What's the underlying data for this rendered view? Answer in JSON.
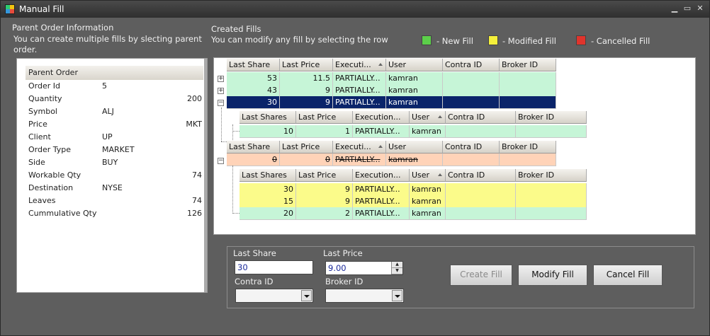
{
  "window": {
    "title": "Manual Fill"
  },
  "parent_section": {
    "title": "Parent Order Information",
    "subtitle": "You can create multiple fills by slecting parent order."
  },
  "parent_order": {
    "header": "Parent Order",
    "rows": [
      {
        "key": "Order Id",
        "value": "5",
        "align": "left"
      },
      {
        "key": "Quantity",
        "value": "200",
        "align": "right"
      },
      {
        "key": "Symbol",
        "value": "ALJ",
        "align": "left"
      },
      {
        "key": "Price",
        "value": "MKT",
        "align": "right"
      },
      {
        "key": "Client",
        "value": "UP",
        "align": "left"
      },
      {
        "key": "Order Type",
        "value": "MARKET",
        "align": "left"
      },
      {
        "key": "Side",
        "value": "BUY",
        "align": "left"
      },
      {
        "key": "Workable Qty",
        "value": "74",
        "align": "right"
      },
      {
        "key": "Destination",
        "value": "NYSE",
        "align": "left"
      },
      {
        "key": "Leaves",
        "value": "74",
        "align": "right"
      },
      {
        "key": "Cummulative Qty",
        "value": "126",
        "align": "right"
      }
    ]
  },
  "fills_section": {
    "title": "Created Fills",
    "subtitle": "You can modify any fill by selecting the row"
  },
  "legend": [
    {
      "color": "#5ccf4a",
      "label": "- New Fill"
    },
    {
      "color": "#f5f03a",
      "label": "- Modified Fill"
    },
    {
      "color": "#e0342c",
      "label": "- Cancelled Fill"
    }
  ],
  "grid": {
    "parent_columns": [
      "Last Share",
      "Last Price",
      "Executi...",
      "User",
      "Contra ID",
      "Broker ID"
    ],
    "child_columns": [
      "Last Shares",
      "Last Price",
      "Execution...",
      "User",
      "Contra ID",
      "Broker ID"
    ],
    "groups": [
      {
        "status": "new",
        "expanded": false,
        "expander": "+",
        "row": {
          "last_share": "53",
          "last_price": "11.5",
          "execution": "PARTIALLY...",
          "user": "kamran",
          "contra_id": "",
          "broker_id": ""
        }
      },
      {
        "status": "new",
        "expanded": false,
        "expander": "+",
        "row": {
          "last_share": "43",
          "last_price": "9",
          "execution": "PARTIALLY...",
          "user": "kamran",
          "contra_id": "",
          "broker_id": ""
        }
      },
      {
        "status": "selected",
        "expanded": true,
        "expander": "−",
        "row": {
          "last_share": "30",
          "last_price": "9",
          "execution": "PARTIALLY...",
          "user": "kamran",
          "contra_id": "",
          "broker_id": ""
        },
        "children": [
          {
            "status": "new",
            "last_shares": "10",
            "last_price": "1",
            "execution": "PARTIALLY...",
            "user": "kamran",
            "contra_id": "",
            "broker_id": ""
          }
        ]
      },
      {
        "status": "cancelled",
        "expanded": true,
        "expander": "−",
        "row": {
          "last_share": "0",
          "last_price": "0",
          "execution": "PARTIALLY...",
          "user": "kamran",
          "contra_id": "",
          "broker_id": ""
        },
        "children": [
          {
            "status": "modified",
            "last_shares": "30",
            "last_price": "9",
            "execution": "PARTIALLY...",
            "user": "kamran",
            "contra_id": "",
            "broker_id": ""
          },
          {
            "status": "modified",
            "last_shares": "15",
            "last_price": "9",
            "execution": "PARTIALLY...",
            "user": "kamran",
            "contra_id": "",
            "broker_id": ""
          },
          {
            "status": "new",
            "last_shares": "20",
            "last_price": "2",
            "execution": "PARTIALLY...",
            "user": "kamran",
            "contra_id": "",
            "broker_id": ""
          }
        ]
      }
    ]
  },
  "editor": {
    "last_share_label": "Last Share",
    "last_share_value": "30",
    "last_price_label": "Last Price",
    "last_price_value": "9.00",
    "contra_id_label": "Contra ID",
    "contra_id_value": "",
    "broker_id_label": "Broker ID",
    "broker_id_value": ""
  },
  "buttons": {
    "create": "Create Fill",
    "modify": "Modify Fill",
    "cancel": "Cancel Fill"
  }
}
